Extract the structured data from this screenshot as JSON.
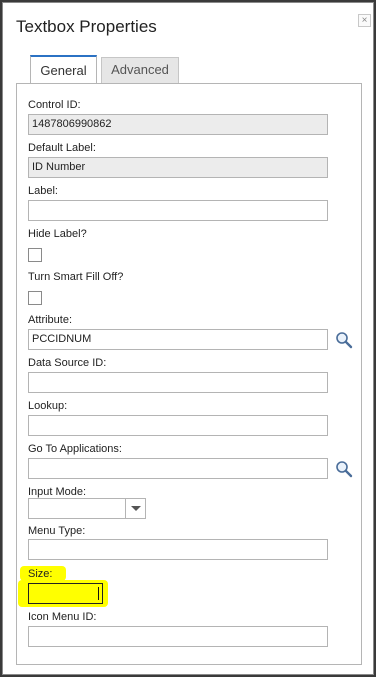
{
  "dialog": {
    "title": "Textbox Properties",
    "close_label": "×"
  },
  "tabs": [
    {
      "label": "General",
      "active": true
    },
    {
      "label": "Advanced",
      "active": false
    }
  ],
  "fields": {
    "control_id": {
      "label": "Control ID:",
      "value": "1487806990862"
    },
    "default_label": {
      "label": "Default Label:",
      "value": "ID Number"
    },
    "label": {
      "label": "Label:",
      "value": ""
    },
    "hide_label": {
      "label": "Hide Label?",
      "checked": false
    },
    "smart_fill_off": {
      "label": "Turn Smart Fill Off?",
      "checked": false
    },
    "attribute": {
      "label": "Attribute:",
      "value": "PCCIDNUM"
    },
    "data_source_id": {
      "label": "Data Source ID:",
      "value": ""
    },
    "lookup": {
      "label": "Lookup:",
      "value": ""
    },
    "go_to_applications": {
      "label": "Go To Applications:",
      "value": ""
    },
    "input_mode": {
      "label": "Input Mode:",
      "value": ""
    },
    "menu_type": {
      "label": "Menu Type:",
      "value": ""
    },
    "size": {
      "label": "Size:",
      "value": ""
    },
    "icon_menu_id": {
      "label": "Icon Menu ID:",
      "value": ""
    }
  },
  "colors": {
    "highlight": "#ffff00",
    "active_tab_accent": "#2b72c4"
  },
  "icons": [
    "close-icon",
    "search-icon",
    "chevron-down-icon"
  ]
}
